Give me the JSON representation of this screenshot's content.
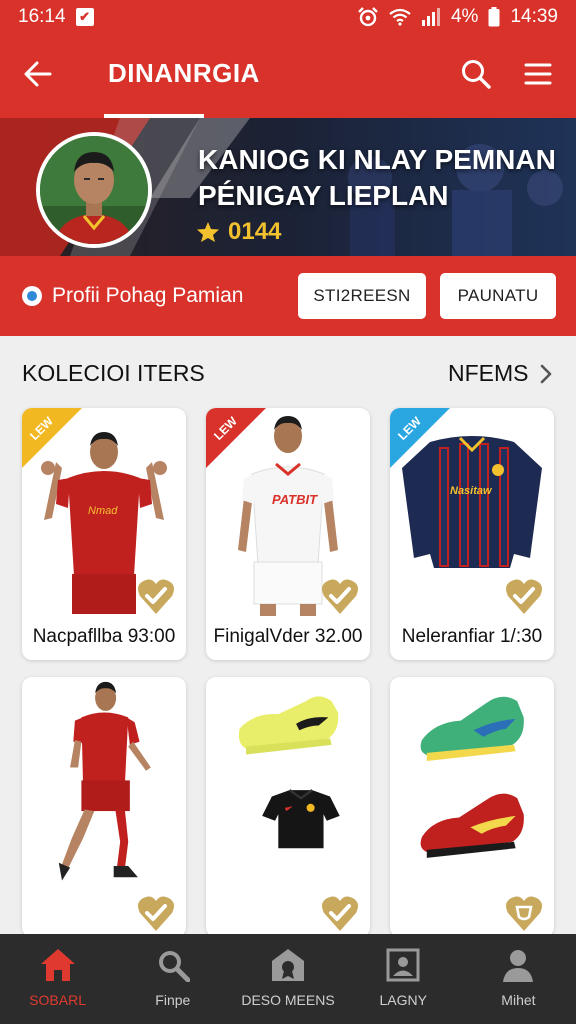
{
  "status_bar": {
    "time_left": "16:14",
    "battery": "4%",
    "time_right": "14:39"
  },
  "app_bar": {
    "title": "DINANRGIA"
  },
  "hero": {
    "line1": "KANIOG KI NLAY PEMNAN",
    "line2": "PÉNIGAY LIEPLAN",
    "score": "0144"
  },
  "profile_bar": {
    "label": "Profii Pohag Pamian",
    "button1": "STI2REESN",
    "button2": "PAUNATU"
  },
  "section": {
    "title": "KOLECIOI ITERS",
    "more": "NFEMS"
  },
  "cards": [
    {
      "price": "Nacpafllba 93:00",
      "ribbon_text": "LEW",
      "ribbon_color": "#f2b822"
    },
    {
      "price": "FinigalVder 32.00",
      "ribbon_text": "LEW",
      "ribbon_color": "#d8322a"
    },
    {
      "price": "Neleranfiar 1/:30",
      "ribbon_text": "LEW",
      "ribbon_color": "#2aa6e0"
    },
    {
      "price": ""
    },
    {
      "price": ""
    },
    {
      "price": ""
    }
  ],
  "bottom_nav": [
    {
      "label": "SOBARL",
      "icon": "home-icon"
    },
    {
      "label": "Finpe",
      "icon": "search-icon"
    },
    {
      "label": "DESO MEENS",
      "icon": "badge-icon"
    },
    {
      "label": "LAGNY",
      "icon": "gallery-icon"
    },
    {
      "label": "Mihet",
      "icon": "person-icon"
    }
  ],
  "colors": {
    "brand_red": "#d8322a",
    "gold": "#c8a85c",
    "nav_bg": "#2c2c2c"
  }
}
